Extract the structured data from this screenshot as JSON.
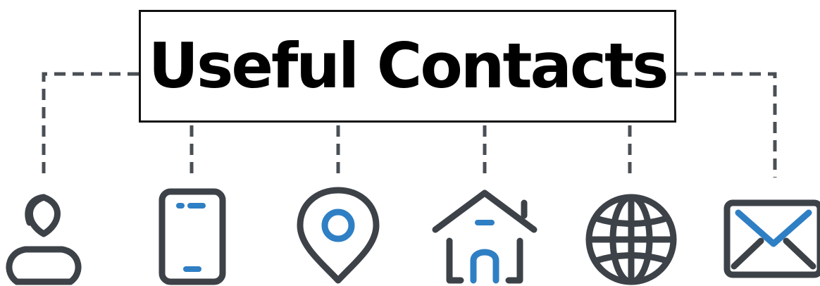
{
  "title": "Useful Contacts",
  "colors": {
    "outline": "#3d4248",
    "accent": "#2f7fc4",
    "connector": "#4a4f55"
  },
  "icons": [
    {
      "name": "person-icon"
    },
    {
      "name": "phone-icon"
    },
    {
      "name": "location-pin-icon"
    },
    {
      "name": "home-icon"
    },
    {
      "name": "globe-icon"
    },
    {
      "name": "email-icon"
    }
  ]
}
